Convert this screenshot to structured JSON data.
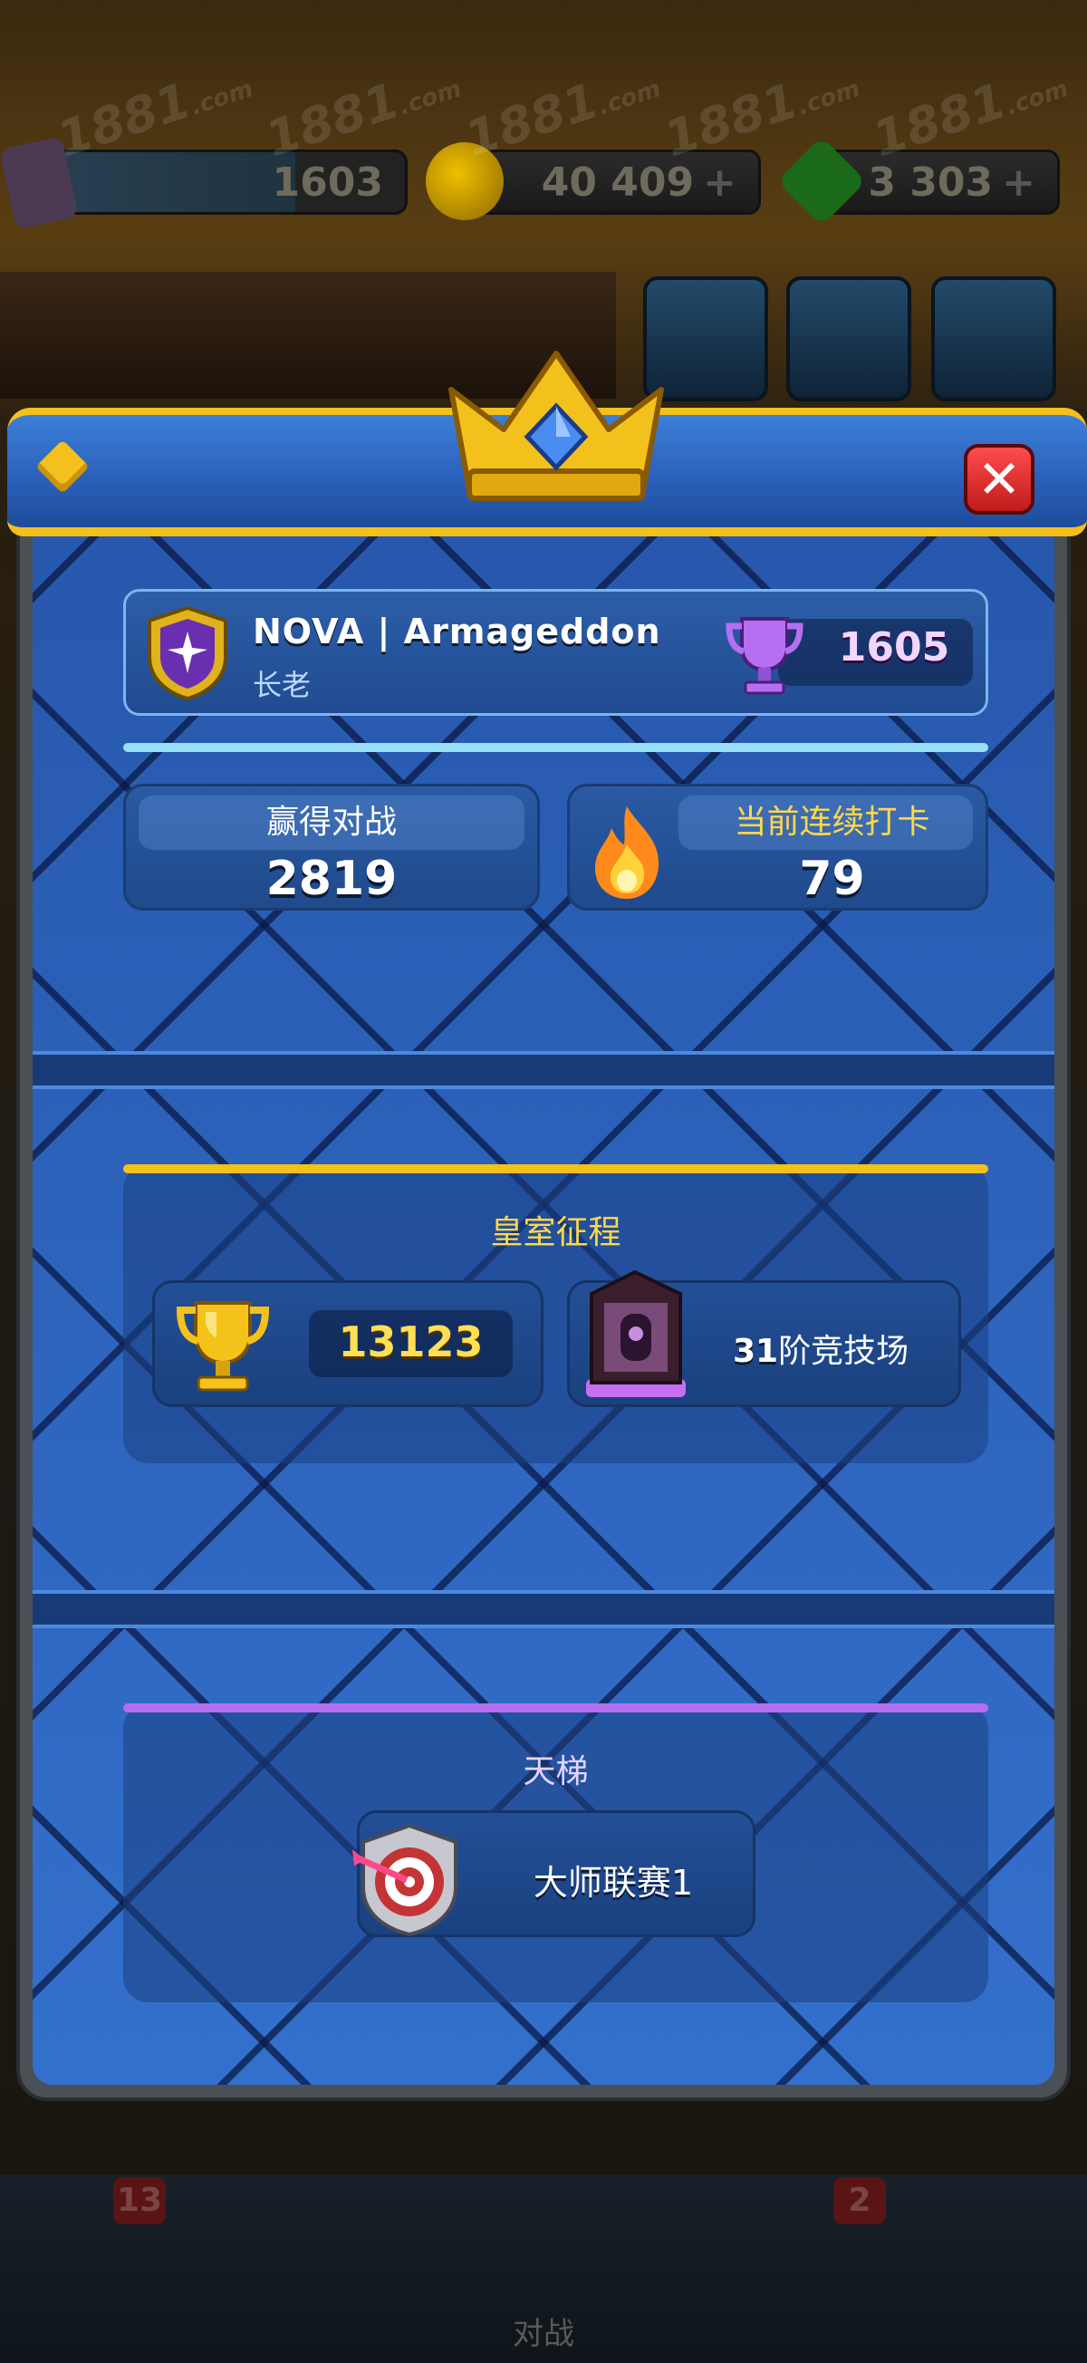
{
  "hud": {
    "xp_value": "1603",
    "gold_value": "40 409",
    "gems_value": "3 303",
    "plus": "+"
  },
  "watermark": {
    "text": "1881",
    "suffix": ".com"
  },
  "nav": {
    "cards_badge": "13",
    "clan_badge": "2",
    "battle_label": "对战"
  },
  "modal": {
    "close_symbol": "✕",
    "player": {
      "name": "NOVA | Armageddon",
      "role": "长老",
      "trophies": "1605"
    },
    "stats": {
      "wins_label": "赢得对战",
      "wins_value": "2819",
      "streak_label": "当前连续打卡",
      "streak_value": "79"
    },
    "royal_road": {
      "title": "皇室征程",
      "trophies": "13123",
      "arena_number": "31",
      "arena_suffix": "阶竞技场"
    },
    "ladder": {
      "title": "天梯",
      "league": "大师联赛1"
    }
  },
  "colors": {
    "accent_gold": "#f4c11a",
    "panel_blue": "#2a5bb2",
    "close_red": "#d42222",
    "ladder_purple": "#b46ef0",
    "divider_cyan": "#97e0f7"
  },
  "icons": [
    "crown-icon",
    "gem-diamond-icon",
    "close-icon",
    "clan-badge-icon",
    "trophy-icon",
    "flame-icon",
    "gold-cup-icon",
    "arena-icon",
    "league-target-icon"
  ]
}
